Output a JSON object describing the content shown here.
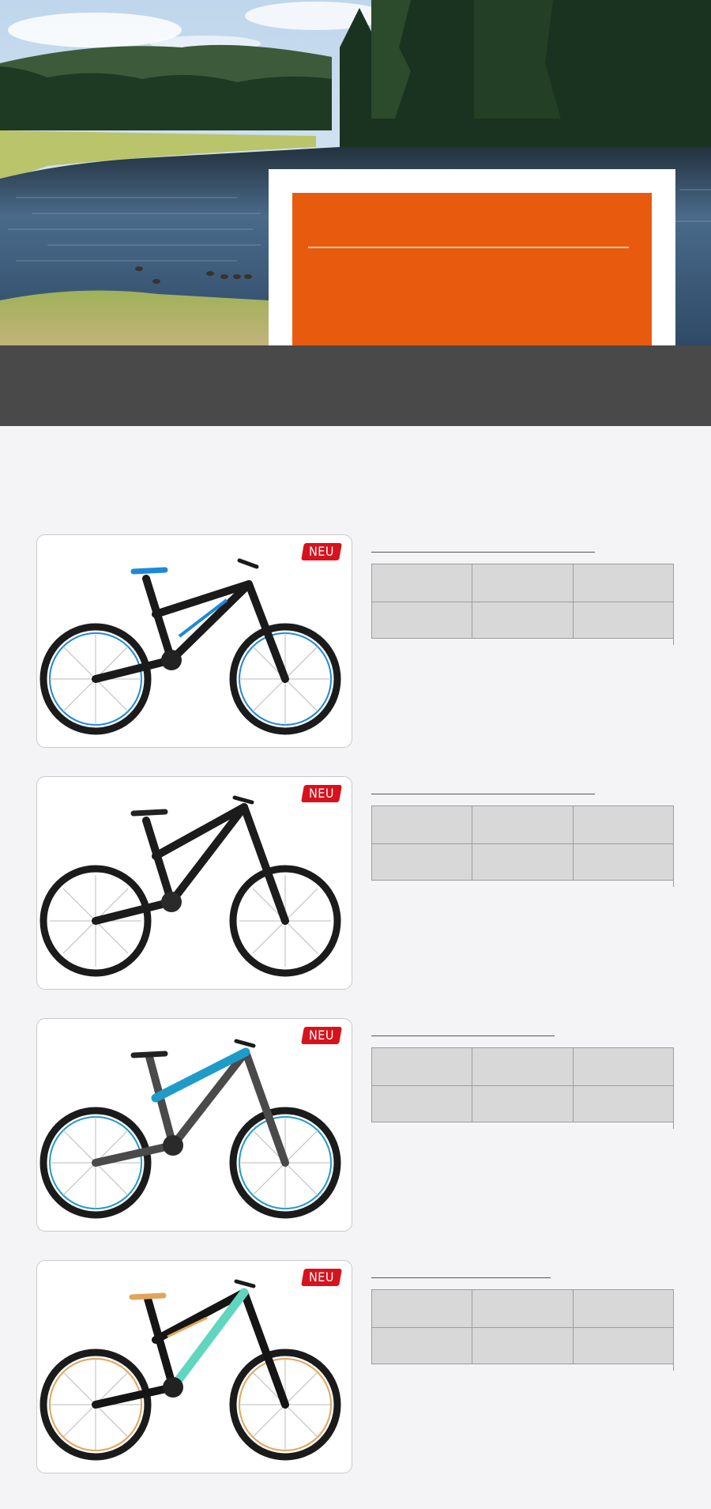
{
  "hero": {
    "colors": {
      "sky": "#cfe0ef",
      "forest": "#1f3a22",
      "lake": "#3a5672",
      "grass": "#a7b85a",
      "card_accent": "#e85b0f"
    }
  },
  "products": [
    {
      "badge": "NEU",
      "frame_color": "#1a1a1a",
      "accent_color": "#1e88d8",
      "title": "",
      "specs": [
        [
          "",
          "",
          ""
        ],
        [
          "",
          "",
          ""
        ]
      ]
    },
    {
      "badge": "NEU",
      "frame_color": "#1c1c1c",
      "accent_color": "#3a3a3a",
      "title": "",
      "specs": [
        [
          "",
          "",
          ""
        ],
        [
          "",
          "",
          ""
        ]
      ]
    },
    {
      "badge": "NEU",
      "frame_color": "#4a4a4a",
      "accent_color": "#1e9bc9",
      "title": "",
      "specs": [
        [
          "",
          "",
          ""
        ],
        [
          "",
          "",
          ""
        ]
      ]
    },
    {
      "badge": "NEU",
      "frame_color": "#151515",
      "accent_color": "#5fd6bd",
      "title": "",
      "specs": [
        [
          "",
          "",
          ""
        ],
        [
          "",
          "",
          ""
        ]
      ]
    }
  ]
}
